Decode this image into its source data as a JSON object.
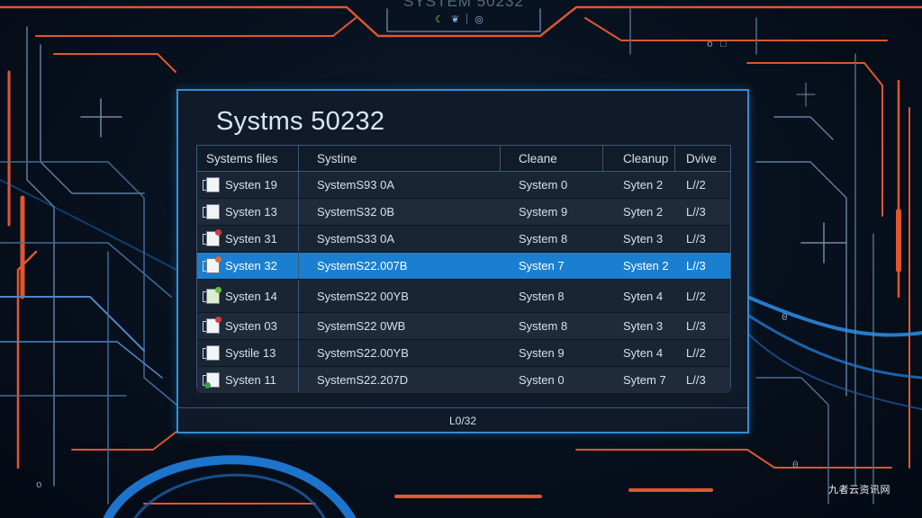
{
  "window": {
    "top_title": "SYSTEM 50232",
    "title": "Systms 50232"
  },
  "top_icons": [
    "moon-icon",
    "leaf-icon",
    "ring-icon"
  ],
  "table": {
    "columns": [
      "Systems files",
      "Systine",
      "Cleane",
      "Cleanup",
      "Dvive"
    ],
    "rows": [
      {
        "file": "Systen 19",
        "systine": "SystemS93 0A",
        "cleane": "System 0",
        "cleanup": "Syten 2",
        "drive": "L//2",
        "icon": "plain",
        "selected": false
      },
      {
        "file": "Systen 13",
        "systine": "SystemS32 0B",
        "cleane": "System 9",
        "cleanup": "Syten 2",
        "drive": "L//3",
        "icon": "plain",
        "selected": false
      },
      {
        "file": "Systen 31",
        "systine": "SystemS33 0A",
        "cleane": "System 8",
        "cleanup": "Syten 3",
        "drive": "L//3",
        "icon": "red",
        "selected": false
      },
      {
        "file": "Systen 32",
        "systine": "SystemS22.007B",
        "cleane": "Systen 7",
        "cleanup": "Systen 2",
        "drive": "L//3",
        "icon": "orange",
        "selected": true
      },
      {
        "file": "Systen 14",
        "systine": "SystemS22 00YB",
        "cleane": "Systen 8",
        "cleanup": "Syten 4",
        "drive": "L//2",
        "icon": "green",
        "selected": false
      },
      {
        "file": "Systen 03",
        "systine": "SystemS22 0WB",
        "cleane": "System 8",
        "cleanup": "Syten 3",
        "drive": "L//3",
        "icon": "red",
        "selected": false
      },
      {
        "file": "Systile 13",
        "systine": "SystemS22.00YB",
        "cleane": "Systen 9",
        "cleanup": "Syten 4",
        "drive": "L//2",
        "icon": "plain",
        "selected": false
      },
      {
        "file": "Systen 11",
        "systine": "SystemS22.207D",
        "cleane": "Systen 0",
        "cleanup": "Sytem 7",
        "drive": "L//3",
        "icon": "greenb",
        "selected": false
      }
    ]
  },
  "footer": {
    "text": "L0/32"
  },
  "watermark": {
    "text": "九者云资讯网"
  },
  "colors": {
    "accent_blue": "#2f8fd8",
    "selection": "#1a7fd0",
    "circuit_orange": "#e0562f",
    "background": "#07101d"
  }
}
